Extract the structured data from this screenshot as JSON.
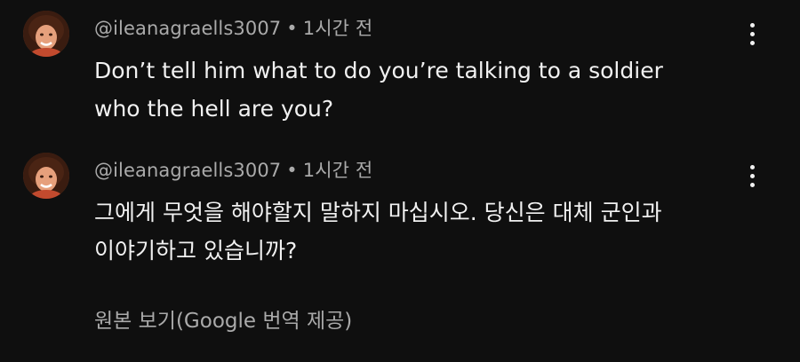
{
  "comments": [
    {
      "author": "@ileanagraells3007",
      "separator": "•",
      "timestamp": "1시간 전",
      "text_lines": [
        "Don’t tell him what to do you’re talking to a soldier",
        "who the hell are you?"
      ],
      "avatar_icon": "user-avatar-photo",
      "menu_icon": "more-vert-icon"
    },
    {
      "author": "@ileanagraells3007",
      "separator": "•",
      "timestamp": "1시간 전",
      "text_lines": [
        "그에게 무엇을 해야할지 말하지 마십시오. 당신은 대체 군인과",
        "이야기하고 있습니까?"
      ],
      "avatar_icon": "user-avatar-photo",
      "menu_icon": "more-vert-icon",
      "translation_toggle": "원본 보기(Google 번역 제공)"
    }
  ],
  "colors": {
    "background": "#0f0f0f",
    "primary_text": "#f1f1f1",
    "secondary_text": "#aaaaaa"
  }
}
